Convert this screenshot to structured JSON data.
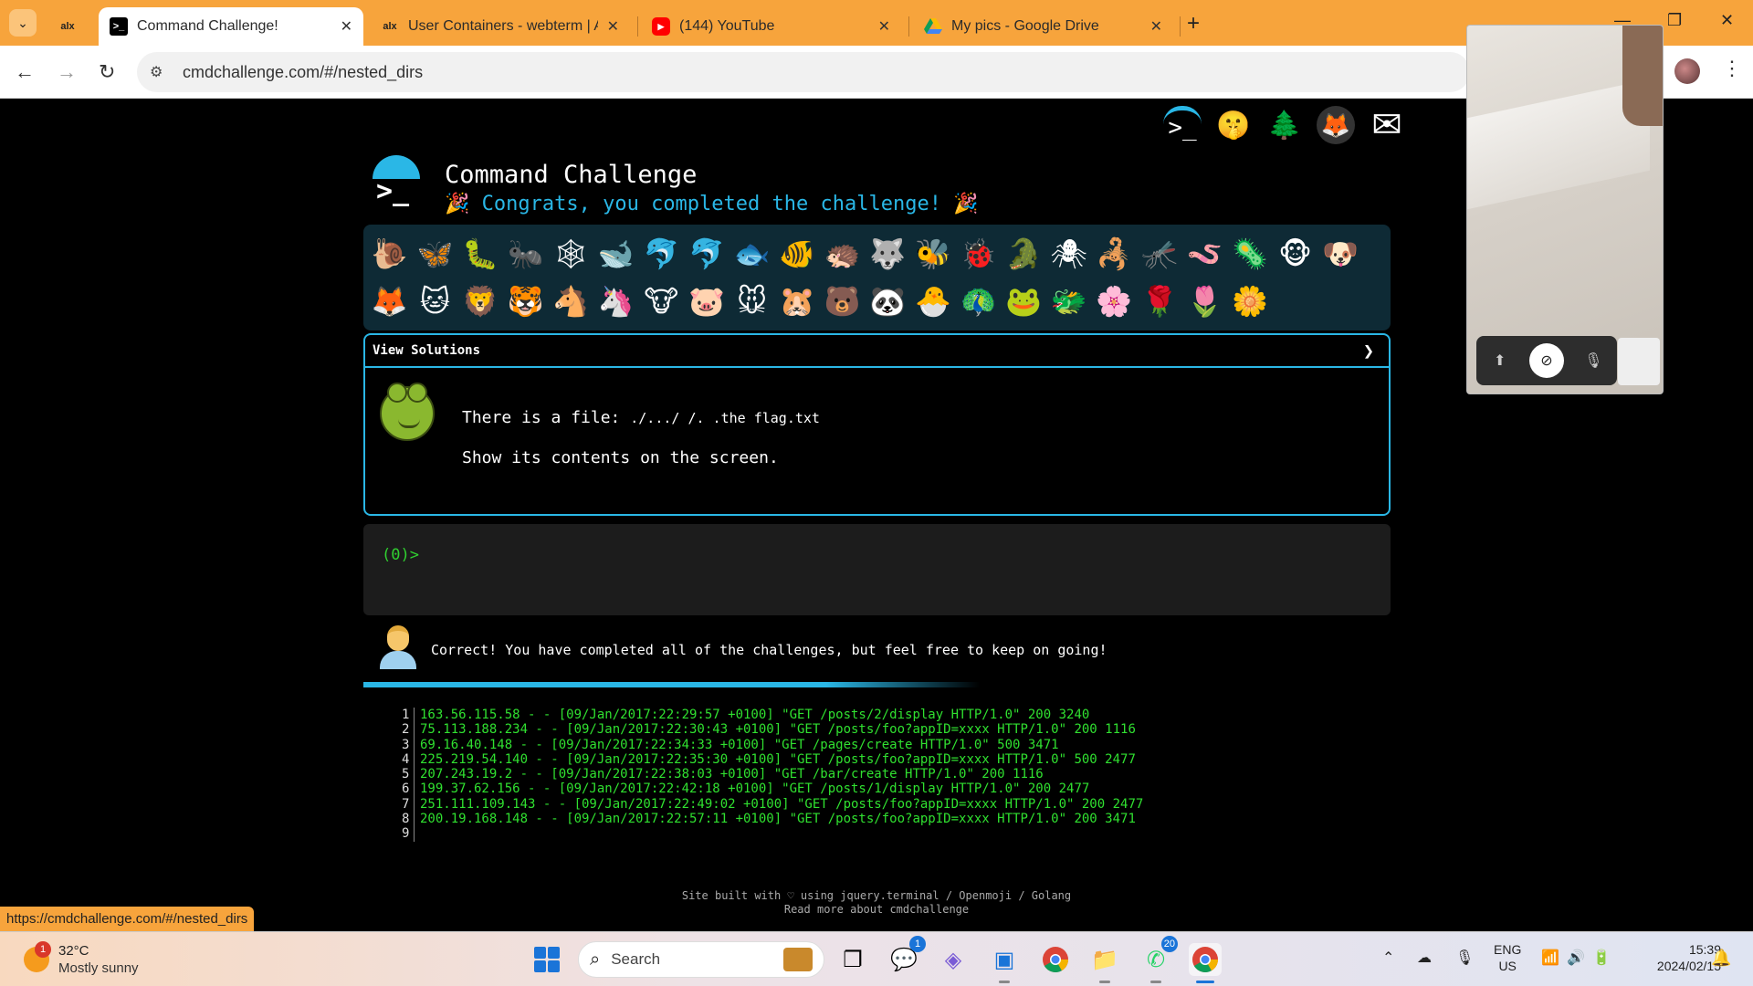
{
  "browser": {
    "tabs": [
      {
        "label": "",
        "favicon": "alx",
        "active": false
      },
      {
        "label": "Command Challenge!",
        "favicon": ">_",
        "active": true
      },
      {
        "label": "User Containers - webterm | ALX",
        "favicon": "alx",
        "active": false
      },
      {
        "label": "(144) YouTube",
        "favicon": "youtube-icon",
        "active": false
      },
      {
        "label": "My pics - Google Drive",
        "favicon": "google-drive-icon",
        "active": false
      }
    ],
    "new_tab": "+",
    "url": "cmdchallenge.com/#/nested_dirs",
    "status_url": "https://cmdchallenge.com/#/nested_dirs"
  },
  "site": {
    "title": "Command Challenge",
    "congrats": "🎉 Congrats, you completed the challenge! 🎉",
    "top_icons": [
      "terminal-icon",
      "shushing-face-icon",
      "tree-icon",
      "gitlab-icon",
      "mail-icon"
    ],
    "emoji_row1": [
      "🐌",
      "🦋",
      "🐛",
      "🐜",
      "🕸",
      "🐋",
      "🐬",
      "🐬",
      "🐟",
      "🐠",
      "🦔",
      "🐺",
      "🐝",
      "🐞",
      "🐊",
      "🕷",
      "🦂",
      "🦟",
      "🪱",
      "🦠",
      "🐵",
      "🐶"
    ],
    "emoji_row2": [
      "🦊",
      "🐱",
      "🦁",
      "🐯",
      "🐴",
      "🦄",
      "🐮",
      "🐷",
      "🐭",
      "🐹",
      "🐻",
      "🐼",
      "🐣",
      "🦚",
      "🐸",
      "🐲",
      "🌸",
      "🌹",
      "🌷",
      "🌼"
    ],
    "challenge": {
      "header": "View Solutions",
      "chevron": "❯",
      "line1_prefix": "There is a file: ",
      "line1_path": "./.../ /. .the flag.txt",
      "line2": "Show its contents on the screen."
    },
    "terminal_prompt": "(0)>",
    "result_text": "Correct! You have completed all of the challenges, but feel free to keep on going!",
    "log_lines": [
      {
        "n": "1",
        "text": "163.56.115.58 - - [09/Jan/2017:22:29:57 +0100] \"GET /posts/2/display HTTP/1.0\" 200 3240"
      },
      {
        "n": "2",
        "text": "75.113.188.234 - - [09/Jan/2017:22:30:43 +0100] \"GET /posts/foo?appID=xxxx HTTP/1.0\" 200 1116"
      },
      {
        "n": "3",
        "text": "69.16.40.148 - - [09/Jan/2017:22:34:33 +0100] \"GET /pages/create HTTP/1.0\" 500 3471"
      },
      {
        "n": "4",
        "text": "225.219.54.140 - - [09/Jan/2017:22:35:30 +0100] \"GET /posts/foo?appID=xxxx HTTP/1.0\" 500 2477"
      },
      {
        "n": "5",
        "text": "207.243.19.2 - - [09/Jan/2017:22:38:03 +0100] \"GET /bar/create HTTP/1.0\" 200 1116"
      },
      {
        "n": "6",
        "text": "199.37.62.156 - - [09/Jan/2017:22:42:18 +0100] \"GET /posts/1/display HTTP/1.0\" 200 2477"
      },
      {
        "n": "7",
        "text": "251.111.109.143 - - [09/Jan/2017:22:49:02 +0100] \"GET /posts/foo?appID=xxxx HTTP/1.0\" 200 2477"
      },
      {
        "n": "8",
        "text": "200.19.168.148 - - [09/Jan/2017:22:57:11 +0100] \"GET /posts/foo?appID=xxxx HTTP/1.0\" 200 3471"
      },
      {
        "n": "9",
        "text": ""
      }
    ],
    "footer_line1": "Site built with ♡ using jquery.terminal / Openmoji / Golang",
    "footer_line2": "Read more about cmdchallenge"
  },
  "taskbar": {
    "weather_badge": "1",
    "temperature": "32°C",
    "condition": "Mostly sunny",
    "search_placeholder": "Search",
    "teams_badge": "1",
    "whatsapp_badge": "20",
    "lang_line1": "ENG",
    "lang_line2": "US",
    "time": "15:39",
    "date": "2024/02/15"
  },
  "colors": {
    "accent": "#2ab7e6",
    "terminal_green": "#30e030",
    "chrome_orange": "#f7a43c"
  }
}
